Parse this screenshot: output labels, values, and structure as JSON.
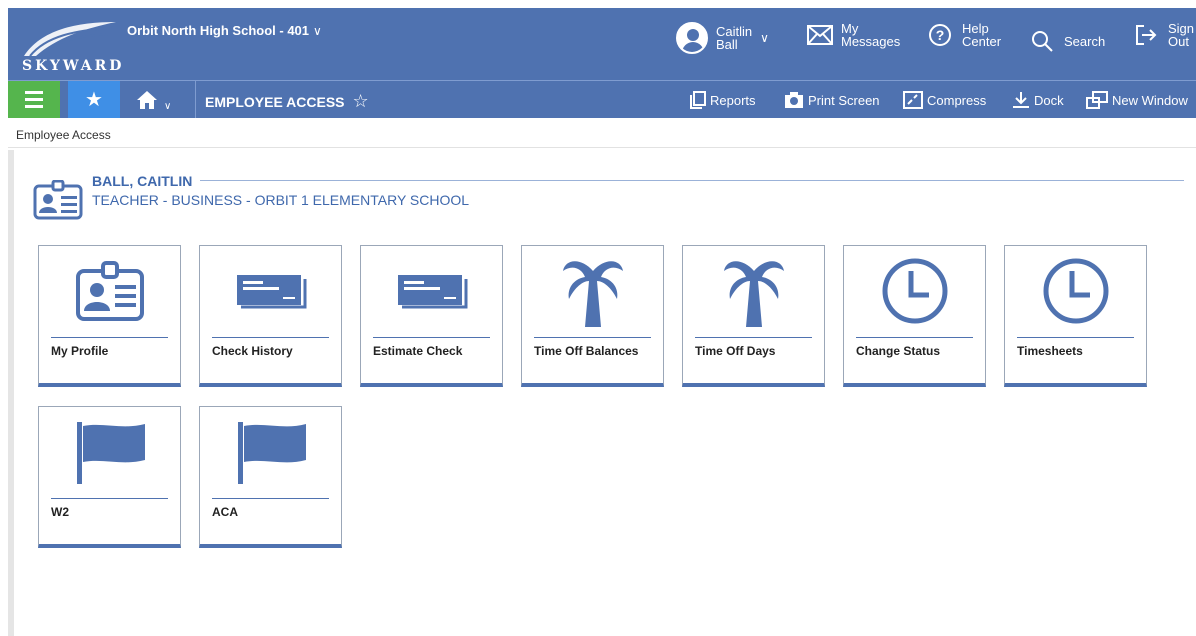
{
  "header": {
    "logo_text": "SKYWARD",
    "school": "Orbit North High School - 401",
    "user": {
      "line1": "Caitlin",
      "line2": "Ball"
    },
    "messages": {
      "line1": "My",
      "line2": "Messages"
    },
    "help": {
      "line1": "Help",
      "line2": "Center"
    },
    "search": "Search",
    "signout": {
      "line1": "Sign",
      "line2": "Out"
    }
  },
  "navbar": {
    "title": "EMPLOYEE ACCESS",
    "tools": [
      "Reports",
      "Print Screen",
      "Compress",
      "Dock",
      "New Window"
    ]
  },
  "breadcrumb": "Employee Access",
  "employee": {
    "name": "BALL, CAITLIN",
    "role": "TEACHER - BUSINESS - ORBIT 1 ELEMENTARY SCHOOL"
  },
  "tiles": [
    {
      "label": "My Profile",
      "icon": "id-card-icon"
    },
    {
      "label": "Check History",
      "icon": "check-icon"
    },
    {
      "label": "Estimate Check",
      "icon": "check-icon"
    },
    {
      "label": "Time Off Balances",
      "icon": "palm-tree-icon"
    },
    {
      "label": "Time Off Days",
      "icon": "palm-tree-icon"
    },
    {
      "label": "Change Status",
      "icon": "clock-icon"
    },
    {
      "label": "Timesheets",
      "icon": "clock-icon"
    },
    {
      "label": "W2",
      "icon": "flag-icon"
    },
    {
      "label": "ACA",
      "icon": "flag-icon"
    }
  ],
  "colors": {
    "header": "#4f72b0",
    "menu_green": "#55b54d",
    "fav_blue": "#3f8fe6",
    "accent_text": "#3f68ac"
  }
}
